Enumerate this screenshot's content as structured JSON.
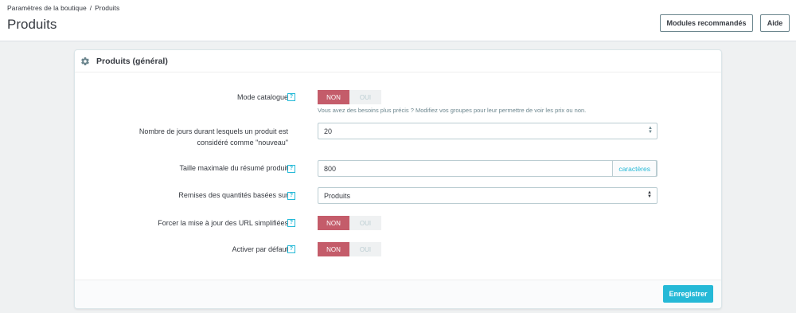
{
  "breadcrumb": {
    "parent": "Paramètres de la boutique",
    "separator": "/",
    "current": "Produits"
  },
  "page": {
    "title": "Produits"
  },
  "toolbar": {
    "modules_label": "Modules recommandés",
    "help_label": "Aide"
  },
  "panel": {
    "title": "Produits (général)",
    "help_glyph": "?",
    "fields": {
      "catalog_mode": {
        "label": "Mode catalogue",
        "no": "NON",
        "yes": "OUI",
        "value": "NON",
        "hint": "Vous avez des besoins plus précis ? Modifiez vos groupes pour leur permettre de voir les prix ou non."
      },
      "new_days": {
        "label_line1": "Nombre de jours durant lesquels un produit est",
        "label_line2": "considéré comme \"nouveau\"",
        "value": "20"
      },
      "summary_max": {
        "label": "Taille maximale du résumé produit",
        "value": "800",
        "suffix": "caractères"
      },
      "qty_discounts": {
        "label": "Remises des quantités basées sur",
        "value": "Produits"
      },
      "force_url": {
        "label": "Forcer la mise à jour des URL simplifiées",
        "no": "NON",
        "yes": "OUI",
        "value": "NON"
      },
      "active_default": {
        "label": "Activer par défaut",
        "no": "NON",
        "yes": "OUI",
        "value": "NON"
      }
    },
    "save_label": "Enregistrer"
  },
  "icons": {
    "gear": "gear-icon",
    "help": "help-icon",
    "spinner": "spinner-arrows-icon",
    "caret": "select-caret-icon"
  },
  "colors": {
    "accent": "#25b9d7",
    "switch_on": "#c45c6a",
    "text": "#363a41"
  }
}
